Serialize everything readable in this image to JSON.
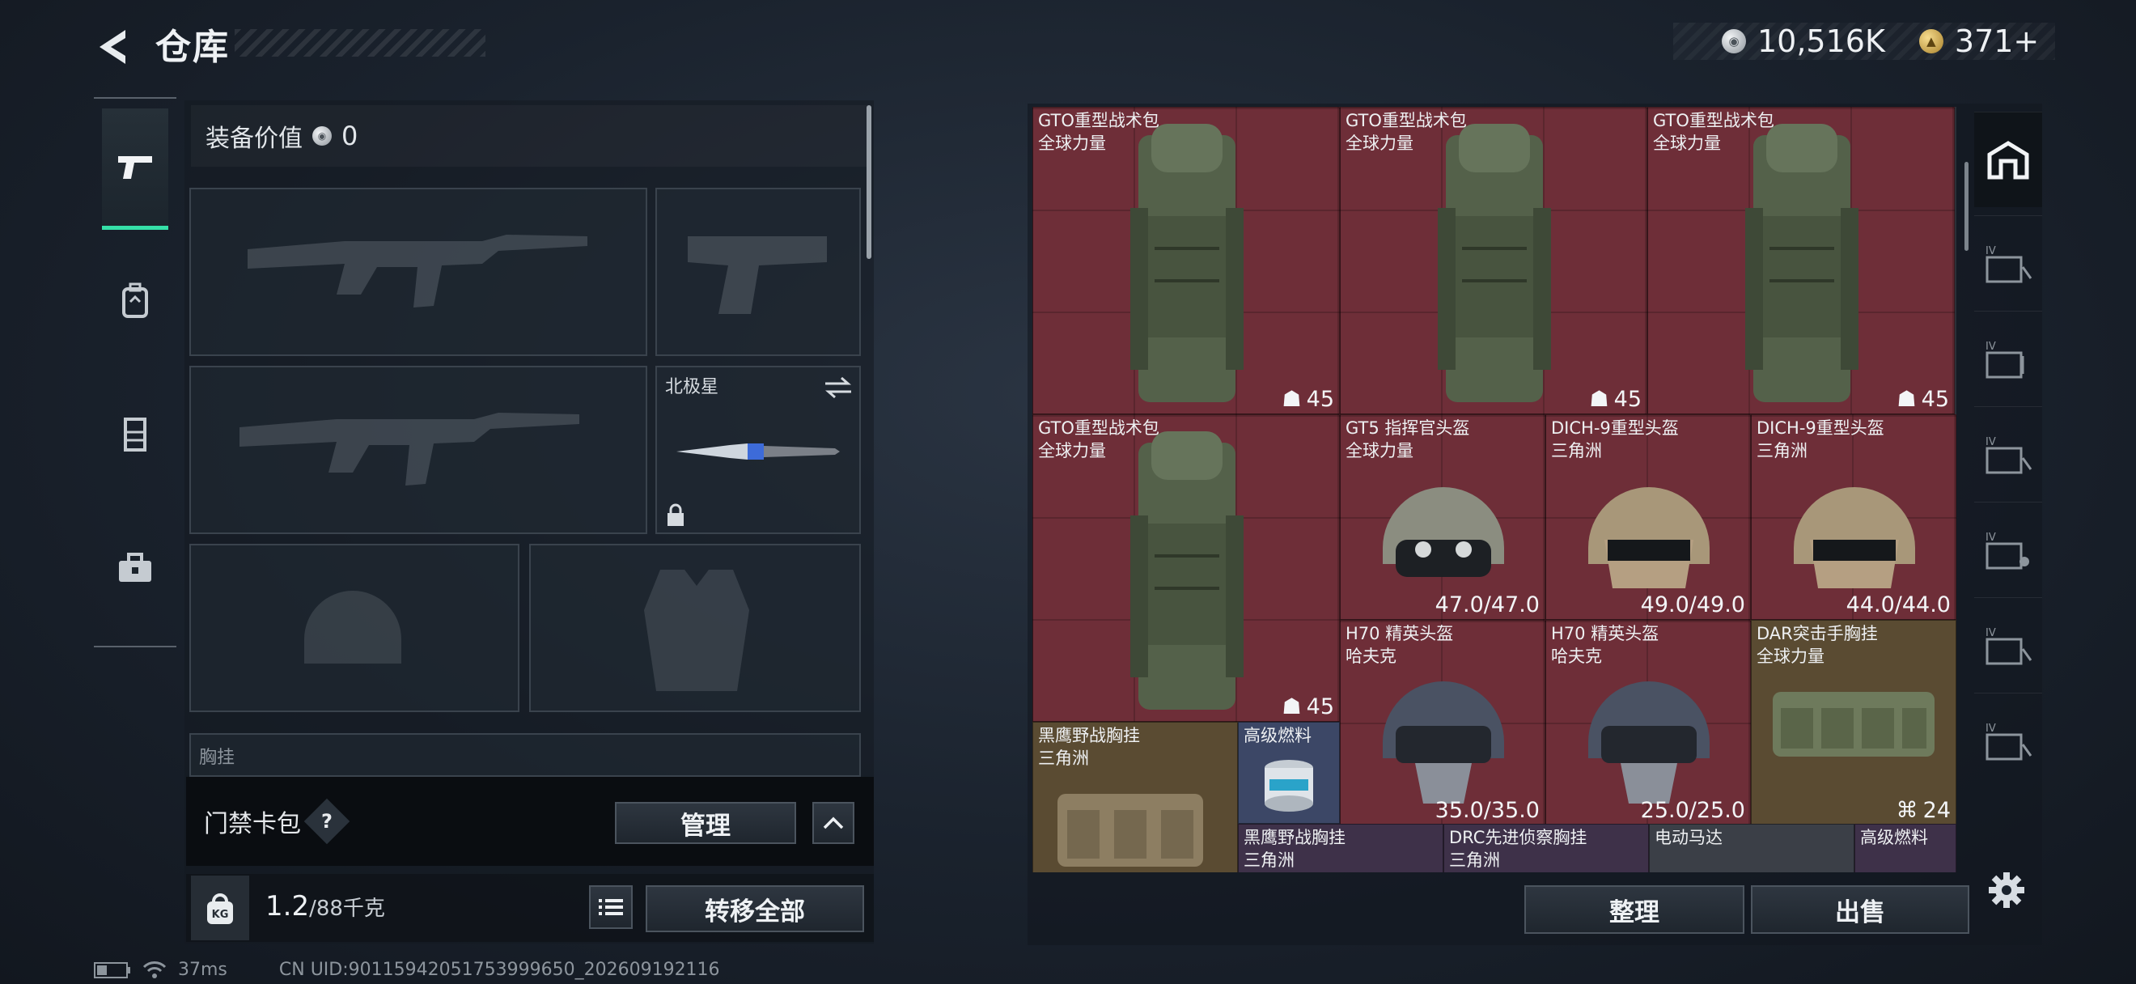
{
  "header": {
    "title": "仓库",
    "currency": [
      {
        "icon": "silver-coin-icon",
        "value": "10,516K"
      },
      {
        "icon": "gold-coin-icon",
        "value": "371+"
      }
    ]
  },
  "left_tabs": [
    {
      "icon": "pistol-icon",
      "active": true
    },
    {
      "icon": "backpack-icon",
      "active": false
    },
    {
      "icon": "vest-icon",
      "active": false
    },
    {
      "icon": "toolbox-icon",
      "active": false
    }
  ],
  "loadout": {
    "value_label": "装备价值",
    "value_amount": "0",
    "melee_name": "北极星",
    "chest_rig_label": "胸挂"
  },
  "card_pack": {
    "label": "门禁卡包",
    "help": "?",
    "manage": "管理"
  },
  "weight": {
    "icon_text": "KG",
    "current": "1.2",
    "max": "/88",
    "unit": "千克"
  },
  "transfer_all": "转移全部",
  "warehouse": {
    "items": [
      {
        "name": "GTO重型战术包",
        "sub": "全球力量",
        "value": "45",
        "icon": "capacity-icon",
        "rarity": "red"
      },
      {
        "name": "GTO重型战术包",
        "sub": "全球力量",
        "value": "45",
        "icon": "capacity-icon",
        "rarity": "red"
      },
      {
        "name": "GTO重型战术包",
        "sub": "全球力量",
        "value": "45",
        "icon": "capacity-icon",
        "rarity": "red"
      },
      {
        "name": "GTO重型战术包",
        "sub": "全球力量",
        "value": "45",
        "icon": "capacity-icon",
        "rarity": "red"
      },
      {
        "name": "GT5 指挥官头盔",
        "sub": "全球力量",
        "value": "47.0/47.0",
        "rarity": "red"
      },
      {
        "name": "DICH-9重型头盔",
        "sub": "三角洲",
        "value": "49.0/49.0",
        "rarity": "red"
      },
      {
        "name": "DICH-9重型头盔",
        "sub": "三角洲",
        "value": "44.0/44.0",
        "rarity": "red"
      },
      {
        "name": "H70 精英头盔",
        "sub": "哈夫克",
        "value": "35.0/35.0",
        "rarity": "red"
      },
      {
        "name": "H70 精英头盔",
        "sub": "哈夫克",
        "value": "25.0/25.0",
        "rarity": "red"
      },
      {
        "name": "DAR突击手胸挂",
        "sub": "全球力量",
        "value": "24",
        "icon": "rig-slots-icon",
        "rarity": "gold"
      },
      {
        "name": "黑鹰野战胸挂",
        "sub": "三角洲",
        "rarity": "gold"
      },
      {
        "name": "高级燃料",
        "sub": "",
        "rarity": "blue"
      },
      {
        "name": "黑鹰野战胸挂",
        "sub": "三角洲",
        "rarity": "purple"
      },
      {
        "name": "DRC先进侦察胸挂",
        "sub": "三角洲",
        "rarity": "purple"
      },
      {
        "name": "电动马达",
        "sub": "",
        "rarity": "grey"
      },
      {
        "name": "高级燃料",
        "sub": "",
        "rarity": "purple"
      }
    ]
  },
  "actions": {
    "sort": "整理",
    "sell": "出售"
  },
  "right_tabs": [
    {
      "icon": "warehouse-home-icon",
      "label": ""
    },
    {
      "icon": "storage-box-icon",
      "label": "IV"
    },
    {
      "icon": "storage-box-icon",
      "label": "IV"
    },
    {
      "icon": "storage-box-icon",
      "label": "IV"
    },
    {
      "icon": "storage-box-icon",
      "label": "IV"
    },
    {
      "icon": "storage-box-icon",
      "label": "IV"
    },
    {
      "icon": "storage-box-icon",
      "label": "IV"
    }
  ],
  "status": {
    "ping": "37ms",
    "uid": "CN UID:90115942051753999650_202609192116"
  }
}
